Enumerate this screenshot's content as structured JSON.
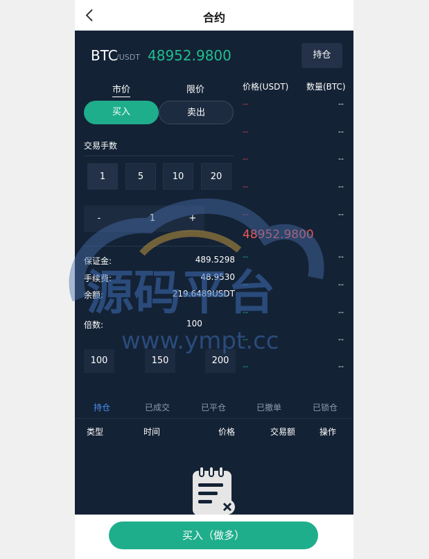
{
  "header": {
    "title": "合约",
    "back_icon": "chevron-left-icon"
  },
  "ticker": {
    "symbol": "BTC",
    "quote": "/USDT",
    "price": "48952.9800",
    "positions_button": "持仓"
  },
  "order_type_tabs": [
    "市价",
    "限价"
  ],
  "side": {
    "buy": "买入",
    "sell": "卖出"
  },
  "lots": {
    "label": "交易手数",
    "options": [
      "1",
      "5",
      "10",
      "20"
    ],
    "selected": "1"
  },
  "stepper": {
    "minus": "-",
    "value": "1",
    "plus": "+"
  },
  "summary": {
    "margin_label": "保证金:",
    "margin_value": "489.5298",
    "fee_label": "手续费:",
    "fee_value": "48.9530",
    "balance_label": "余额:",
    "balance_value": "219.6489USDT"
  },
  "leverage": {
    "label": "倍数:",
    "value": "100",
    "options": [
      "100",
      "150",
      "200"
    ]
  },
  "orderbook": {
    "price_header": "价格(USDT)",
    "qty_header": "数量(BTC)",
    "asks": [
      {
        "price": "--",
        "qty": "--"
      },
      {
        "price": "--",
        "qty": "--"
      },
      {
        "price": "--",
        "qty": "--"
      },
      {
        "price": "--",
        "qty": "--"
      },
      {
        "price": "--",
        "qty": "--"
      }
    ],
    "last_price": "48952.9800",
    "bids": [
      {
        "price": "--",
        "qty": "--"
      },
      {
        "price": "--",
        "qty": "--"
      },
      {
        "price": "--",
        "qty": "--"
      },
      {
        "price": "--",
        "qty": "--"
      },
      {
        "price": "--",
        "qty": "--"
      }
    ]
  },
  "order_tabs": [
    "持仓",
    "已成交",
    "已平仓",
    "已撤单",
    "已锁仓"
  ],
  "order_columns": [
    "类型",
    "时间",
    "价格",
    "交易额",
    "操作"
  ],
  "cta": {
    "label": "买入（做多）"
  },
  "watermark": {
    "cn": "源码平台",
    "url": "www.ympt.cc"
  },
  "colors": {
    "accent_green": "#1fae8c",
    "ask_red": "#e04b4b",
    "bg": "#142235"
  }
}
